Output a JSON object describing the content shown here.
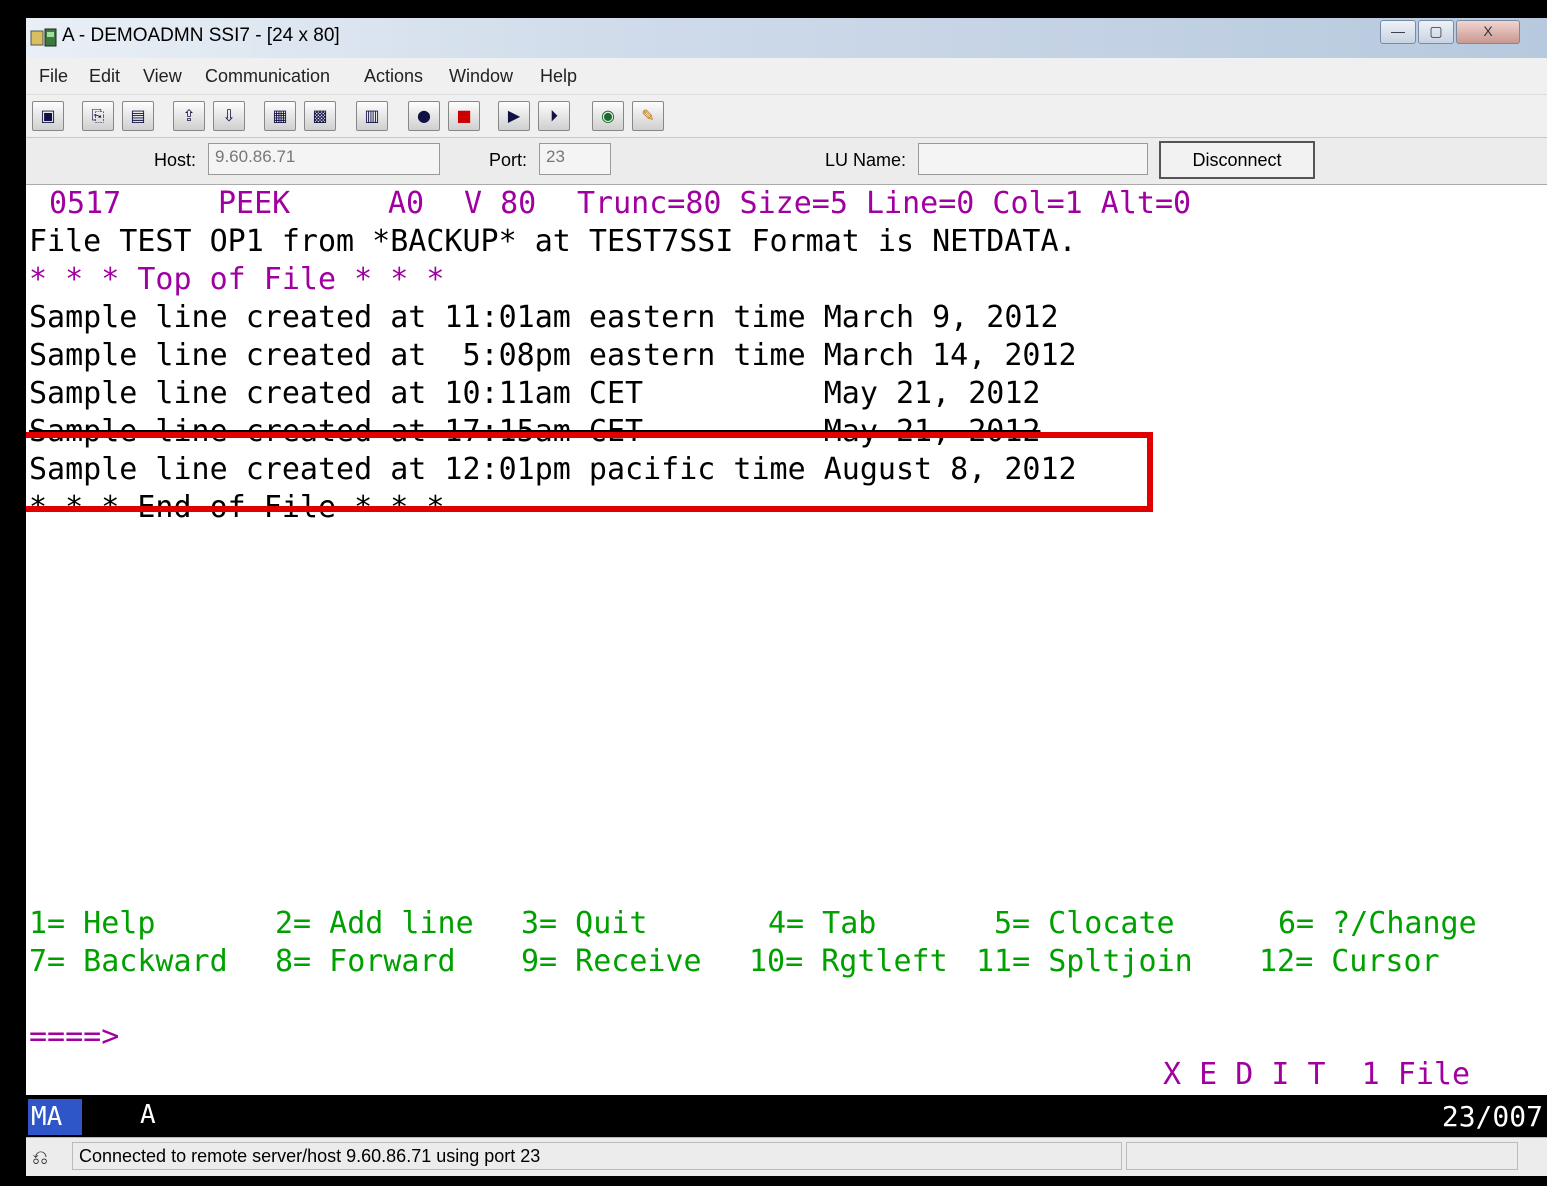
{
  "window": {
    "title": "A - DEMOADMN SSI7 - [24 x 80]",
    "min_glyph": "—",
    "max_glyph": "▢",
    "close_glyph": "X"
  },
  "menu": [
    "File",
    "Edit",
    "View",
    "Communication",
    "Actions",
    "Window",
    "Help"
  ],
  "toolbar_icons": [
    "print-screen-icon",
    "copy-icon",
    "paste-icon",
    "send-file-icon",
    "receive-file-icon",
    "display-icon",
    "keypad-icon",
    "macro-icon",
    "record-macro-icon",
    "stop-macro-icon",
    "play-macro-icon",
    "run-macro-icon",
    "web-icon",
    "edit-icon"
  ],
  "connection": {
    "host_label": "Host:",
    "host_value": "9.60.86.71",
    "port_label": "Port:",
    "port_value": "23",
    "lu_label": "LU Name:",
    "lu_value": "",
    "disconnect_label": "Disconnect"
  },
  "terminal": {
    "header": {
      "fileid": "0517",
      "mode": "PEEK",
      "filemode": "A0",
      "format": "V 80",
      "status": "Trunc=80 Size=5 Line=0 Col=1 Alt=0"
    },
    "file_info": "File TEST OP1 from *BACKUP* at TEST7SSI Format is NETDATA.",
    "top_marker": "* * * Top of File * * *",
    "lines": [
      "Sample line created at 11:01am eastern time March 9, 2012",
      "Sample line created at  5:08pm eastern time March 14, 2012",
      "Sample line created at 10:11am CET          May 21, 2012",
      "Sample line created at 17:15am CET          May 21, 2012",
      "Sample line created at 12:01pm pacific time August 8, 2012"
    ],
    "end_marker": "* * * End of File * * *",
    "pf_row1": [
      "1= Help",
      "2= Add line",
      "3= Quit",
      "4= Tab",
      "5= Clocate",
      "6= ?/Change"
    ],
    "pf_row2": [
      "7= Backward",
      "8= Forward",
      "9= Receive",
      "10= Rgtleft",
      "11= Spltjoin",
      "12= Cursor"
    ],
    "prompt": "====>",
    "xedit_status": "X E D I T  1 File"
  },
  "oia": {
    "indicator": "MA",
    "session": "A",
    "cursor_pos": "23/007"
  },
  "status": {
    "message": "Connected to remote server/host 9.60.86.71 using port 23"
  },
  "colors": {
    "protected_text": "#a000a0",
    "pf_keys": "#00a000",
    "highlight_box": "#e00000",
    "oia_indicator": "#2e56c8"
  }
}
